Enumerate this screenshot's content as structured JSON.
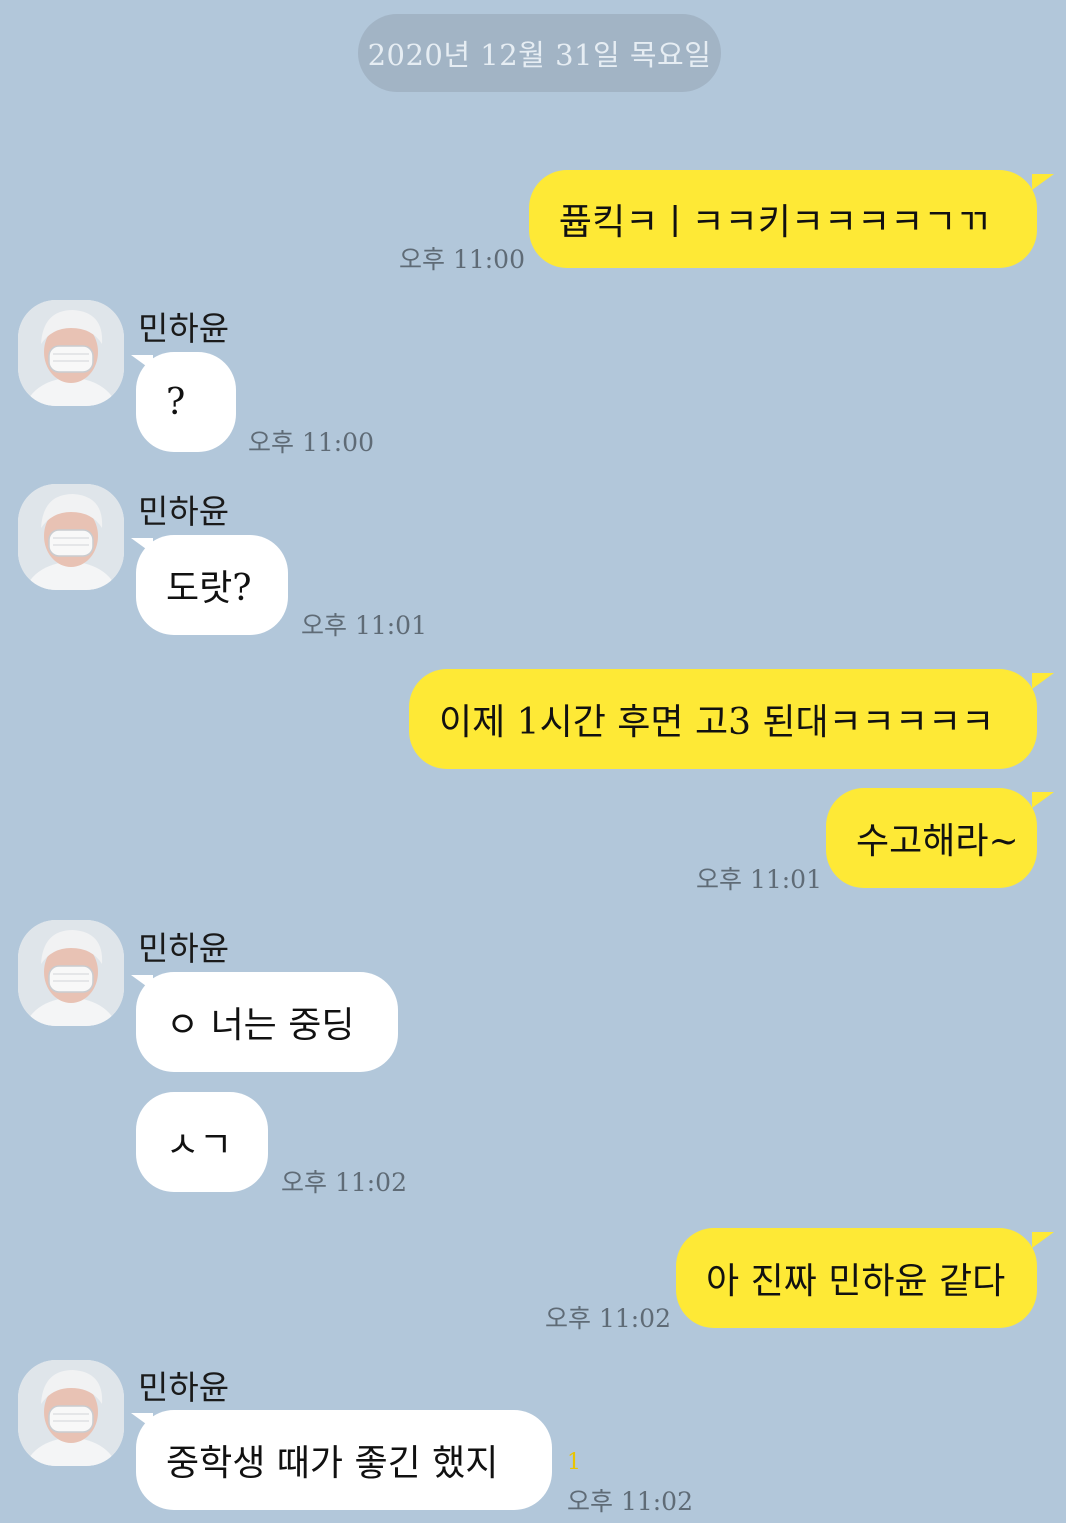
{
  "date_divider": "2020년 12월 31일 목요일",
  "messages": [
    {
      "from": "me",
      "text": "퓹킥ㅋㅣㅋㅋ키ㅋㅋㅋㅋㄱㄲ",
      "time": "오후 11:00"
    },
    {
      "from": "them",
      "sender": "민하윤",
      "text": "?",
      "time": "오후 11:00"
    },
    {
      "from": "them",
      "sender": "민하윤",
      "text": "도랏?",
      "time": "오후 11:01"
    },
    {
      "from": "me",
      "text": "이제 1시간 후면 고3 된대ㅋㅋㅋㅋㅋ",
      "time": ""
    },
    {
      "from": "me",
      "text": "수고해라~",
      "time": "오후 11:01"
    },
    {
      "from": "them",
      "sender": "민하윤",
      "text": "ㅇ 너는 중딩",
      "time": ""
    },
    {
      "from": "them",
      "text": "ㅅㄱ",
      "time": "오후 11:02"
    },
    {
      "from": "me",
      "text": "아 진짜 민하윤 같다",
      "time": "오후 11:02"
    },
    {
      "from": "them",
      "sender": "민하윤",
      "text": "중학생 때가 좋긴 했지",
      "time": "오후 11:02",
      "unread": "1"
    }
  ],
  "colors": {
    "background": "#b2c7da",
    "my_bubble": "#fee936",
    "their_bubble": "#ffffff",
    "date_pill": "#a2b4c5",
    "unread": "#e8c400"
  },
  "icons": {
    "avatar": "profile-photo"
  }
}
